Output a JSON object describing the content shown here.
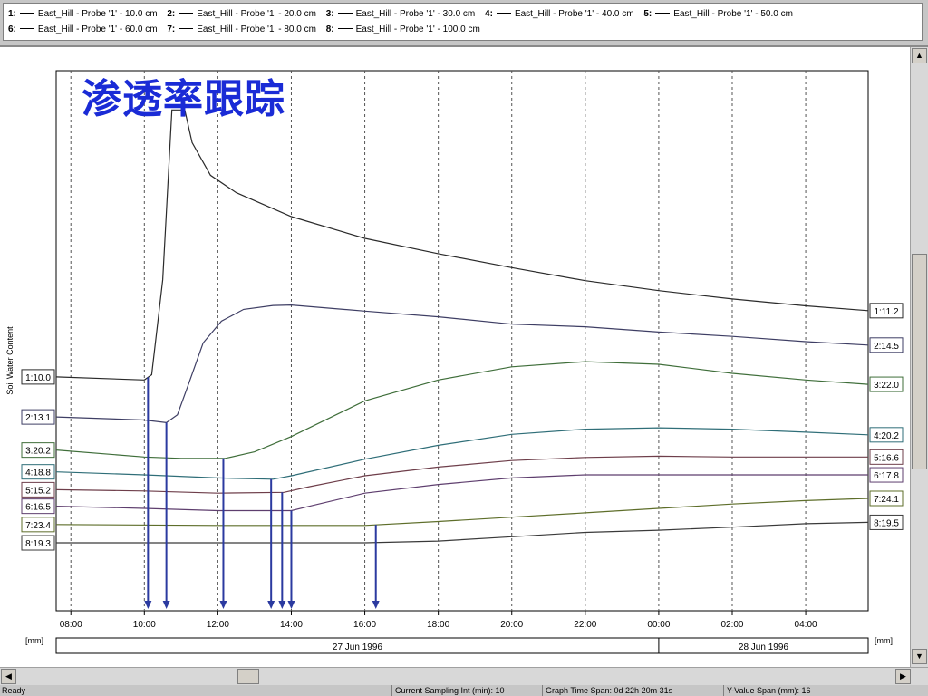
{
  "legend": [
    {
      "num": "1:",
      "label": "East_Hill - Probe '1' - 10.0 cm"
    },
    {
      "num": "2:",
      "label": "East_Hill - Probe '1' - 20.0 cm"
    },
    {
      "num": "3:",
      "label": "East_Hill - Probe '1' - 30.0 cm"
    },
    {
      "num": "4:",
      "label": "East_Hill - Probe '1' - 40.0 cm"
    },
    {
      "num": "5:",
      "label": "East_Hill - Probe '1' - 50.0 cm"
    },
    {
      "num": "6:",
      "label": "East_Hill - Probe '1' - 60.0 cm"
    },
    {
      "num": "7:",
      "label": "East_Hill - Probe '1' - 80.0 cm"
    },
    {
      "num": "8:",
      "label": "East_Hill - Probe '1' - 100.0 cm"
    }
  ],
  "status": {
    "ready": "Ready",
    "sampling": "Current Sampling Int (min): 10",
    "span": "Graph Time Span: 0d 22h 20m 31s",
    "yspan": "Y-Value Span (mm): 16"
  },
  "chart_data": {
    "type": "line",
    "title": "渗透率跟踪",
    "ylabel": "Soil Water Content",
    "unit_left": "[mm]",
    "unit_right": "[mm]",
    "x_ticks": [
      "08:00",
      "10:00",
      "12:00",
      "14:00",
      "16:00",
      "18:00",
      "20:00",
      "22:00",
      "00:00",
      "02:00",
      "04:00"
    ],
    "x_tick_hours": [
      8,
      10,
      12,
      14,
      16,
      18,
      20,
      22,
      24,
      26,
      28
    ],
    "x_range_hours": [
      7.6,
      29.7
    ],
    "dates": [
      {
        "label": "27 Jun 1996",
        "from": 7.6,
        "to": 24.0
      },
      {
        "label": "28 Jun 1996",
        "from": 24.0,
        "to": 29.7
      }
    ],
    "series": [
      {
        "name": "1",
        "color": "#2a2a2a",
        "start_label": "1:10.0",
        "end_label": "1:11.2",
        "points": [
          [
            7.6,
            0.377
          ],
          [
            10.0,
            0.37
          ],
          [
            10.2,
            0.382
          ],
          [
            10.5,
            0.6
          ],
          [
            10.75,
            0.99
          ],
          [
            11.1,
            0.99
          ],
          [
            11.3,
            0.915
          ],
          [
            11.8,
            0.84
          ],
          [
            12.5,
            0.8
          ],
          [
            14.0,
            0.745
          ],
          [
            16.0,
            0.695
          ],
          [
            18.0,
            0.66
          ],
          [
            20.0,
            0.628
          ],
          [
            22.0,
            0.598
          ],
          [
            24.0,
            0.575
          ],
          [
            26.0,
            0.556
          ],
          [
            28.0,
            0.54
          ],
          [
            29.7,
            0.529
          ]
        ]
      },
      {
        "name": "2",
        "color": "#3e3e64",
        "start_label": "2:13.1",
        "end_label": "2:14.5",
        "points": [
          [
            7.6,
            0.285
          ],
          [
            10.0,
            0.278
          ],
          [
            10.6,
            0.272
          ],
          [
            10.9,
            0.29
          ],
          [
            11.2,
            0.36
          ],
          [
            11.6,
            0.455
          ],
          [
            12.1,
            0.505
          ],
          [
            12.7,
            0.532
          ],
          [
            13.5,
            0.541
          ],
          [
            14.0,
            0.542
          ],
          [
            16.0,
            0.528
          ],
          [
            18.0,
            0.515
          ],
          [
            20.0,
            0.498
          ],
          [
            22.0,
            0.492
          ],
          [
            24.0,
            0.48
          ],
          [
            26.0,
            0.47
          ],
          [
            28.0,
            0.458
          ],
          [
            29.7,
            0.45
          ]
        ]
      },
      {
        "name": "3",
        "color": "#3f6e3a",
        "start_label": "3:20.2",
        "end_label": "3:22.0",
        "points": [
          [
            7.6,
            0.209
          ],
          [
            10.0,
            0.193
          ],
          [
            11.0,
            0.19
          ],
          [
            12.2,
            0.19
          ],
          [
            13.0,
            0.205
          ],
          [
            14.0,
            0.24
          ],
          [
            16.0,
            0.322
          ],
          [
            18.0,
            0.37
          ],
          [
            20.0,
            0.4
          ],
          [
            22.0,
            0.412
          ],
          [
            24.0,
            0.406
          ],
          [
            26.0,
            0.385
          ],
          [
            28.0,
            0.37
          ],
          [
            29.7,
            0.36
          ]
        ]
      },
      {
        "name": "4",
        "color": "#2f6e78",
        "start_label": "4:18.8",
        "end_label": "4:20.2",
        "points": [
          [
            7.6,
            0.159
          ],
          [
            10.0,
            0.152
          ],
          [
            12.0,
            0.145
          ],
          [
            13.5,
            0.142
          ],
          [
            14.0,
            0.15
          ],
          [
            16.0,
            0.188
          ],
          [
            18.0,
            0.22
          ],
          [
            20.0,
            0.245
          ],
          [
            22.0,
            0.257
          ],
          [
            24.0,
            0.26
          ],
          [
            26.0,
            0.257
          ],
          [
            28.0,
            0.25
          ],
          [
            29.7,
            0.244
          ]
        ]
      },
      {
        "name": "5",
        "color": "#6e3e4a",
        "start_label": "5:15.2",
        "end_label": "5:16.6",
        "points": [
          [
            7.6,
            0.118
          ],
          [
            10.0,
            0.115
          ],
          [
            12.0,
            0.11
          ],
          [
            13.8,
            0.112
          ],
          [
            14.5,
            0.125
          ],
          [
            16.0,
            0.15
          ],
          [
            18.0,
            0.17
          ],
          [
            20.0,
            0.185
          ],
          [
            22.0,
            0.192
          ],
          [
            24.0,
            0.195
          ],
          [
            26.0,
            0.193
          ],
          [
            28.0,
            0.193
          ],
          [
            29.7,
            0.193
          ]
        ]
      },
      {
        "name": "6",
        "color": "#5e3e6e",
        "start_label": "6:16.5",
        "end_label": "6:17.8",
        "points": [
          [
            7.6,
            0.08
          ],
          [
            10.0,
            0.075
          ],
          [
            12.0,
            0.07
          ],
          [
            14.0,
            0.07
          ],
          [
            14.5,
            0.08
          ],
          [
            16.0,
            0.11
          ],
          [
            18.0,
            0.13
          ],
          [
            20.0,
            0.145
          ],
          [
            22.0,
            0.152
          ],
          [
            24.0,
            0.152
          ],
          [
            26.0,
            0.152
          ],
          [
            28.0,
            0.152
          ],
          [
            29.7,
            0.152
          ]
        ]
      },
      {
        "name": "7",
        "color": "#5e6e2a",
        "start_label": "7:23.4",
        "end_label": "7:24.1",
        "points": [
          [
            7.6,
            0.038
          ],
          [
            12.0,
            0.036
          ],
          [
            16.0,
            0.036
          ],
          [
            18.0,
            0.045
          ],
          [
            20.0,
            0.055
          ],
          [
            22.0,
            0.065
          ],
          [
            24.0,
            0.075
          ],
          [
            26.0,
            0.085
          ],
          [
            28.0,
            0.093
          ],
          [
            29.7,
            0.098
          ]
        ]
      },
      {
        "name": "8",
        "color": "#3a3a3a",
        "start_label": "8:19.3",
        "end_label": "8:19.5",
        "points": [
          [
            7.6,
            -0.004
          ],
          [
            16.0,
            -0.004
          ],
          [
            18.0,
            0.0
          ],
          [
            20.0,
            0.01
          ],
          [
            22.0,
            0.02
          ],
          [
            24.0,
            0.025
          ],
          [
            26.0,
            0.032
          ],
          [
            28.0,
            0.04
          ],
          [
            29.7,
            0.043
          ]
        ]
      }
    ],
    "y_range": [
      -0.16,
      1.08
    ],
    "arrows_hours": [
      10.1,
      10.6,
      12.15,
      13.45,
      13.75,
      14.0,
      16.3
    ],
    "arrow_color": "#2b3aa0",
    "grid": "vertical dashed"
  }
}
